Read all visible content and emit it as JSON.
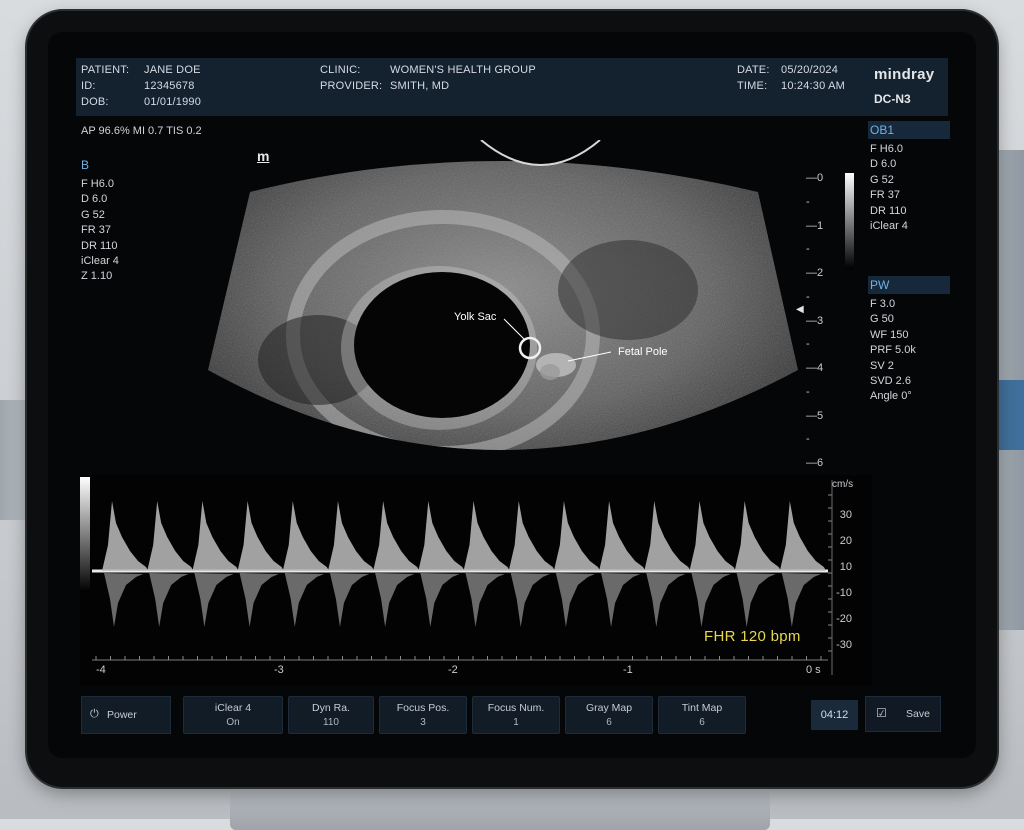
{
  "header": {
    "patient_label": "PATIENT:",
    "patient_value": "JANE DOE",
    "id_label": "ID:",
    "id_value": "12345678",
    "dob_label": "DOB:",
    "dob_value": "01/01/1990",
    "clinic_label": "CLINIC:",
    "clinic_value": "WOMEN'S HEALTH GROUP",
    "provider_label": "PROVIDER:",
    "provider_value": "SMITH, MD",
    "date_label": "DATE:",
    "date_value": "05/20/2024",
    "time_label": "TIME:",
    "time_value": "10:24:30 AM",
    "brand": "mindray",
    "model": "DC-N3"
  },
  "acoustic_output": "AP 96.6%  MI 0.7  TIS 0.2",
  "bmode": {
    "label": "B",
    "params": [
      "F H6.0",
      "D 6.0",
      "G 52",
      "FR 37",
      "DR 110",
      "iClear 4",
      "Z 1.10"
    ]
  },
  "ob1": {
    "label": "OB1",
    "params": [
      "F H6.0",
      "D 6.0",
      "G 52",
      "FR 37",
      "DR 110",
      "iClear 4"
    ]
  },
  "pw": {
    "label": "PW",
    "params": [
      "F 3.0",
      "G 50",
      "WF 150",
      "PRF  5.0k",
      "SV 2",
      "SVD 2.6",
      "Angle 0°"
    ]
  },
  "probe_logo": "m",
  "depth_scale": [
    "0",
    "1",
    "2",
    "3",
    "4",
    "5",
    "6"
  ],
  "annotations": {
    "yolk_sac": "Yolk Sac",
    "fetal_pole": "Fetal Pole"
  },
  "doppler": {
    "unit": "cm/s",
    "velocity_ticks": [
      "30",
      "20",
      "10",
      "-10",
      "-20",
      "-30"
    ],
    "time_ticks": [
      "-4",
      "-3",
      "-2",
      "-1",
      "0 s"
    ],
    "fhr": "FHR  120 bpm"
  },
  "softkeys": {
    "power": "Power",
    "items": [
      {
        "label": "iClear 4",
        "value": "On"
      },
      {
        "label": "Dyn Ra.",
        "value": "110"
      },
      {
        "label": "Focus Pos.",
        "value": "3"
      },
      {
        "label": "Focus Num.",
        "value": "1"
      },
      {
        "label": "Gray Map",
        "value": "6"
      },
      {
        "label": "Tint Map",
        "value": "6"
      }
    ],
    "clock": "04:12",
    "save": "Save"
  },
  "colors": {
    "mode_label": "#6fb1e3",
    "fhr_text": "#e6d84a",
    "header_bg": "#14212f"
  }
}
